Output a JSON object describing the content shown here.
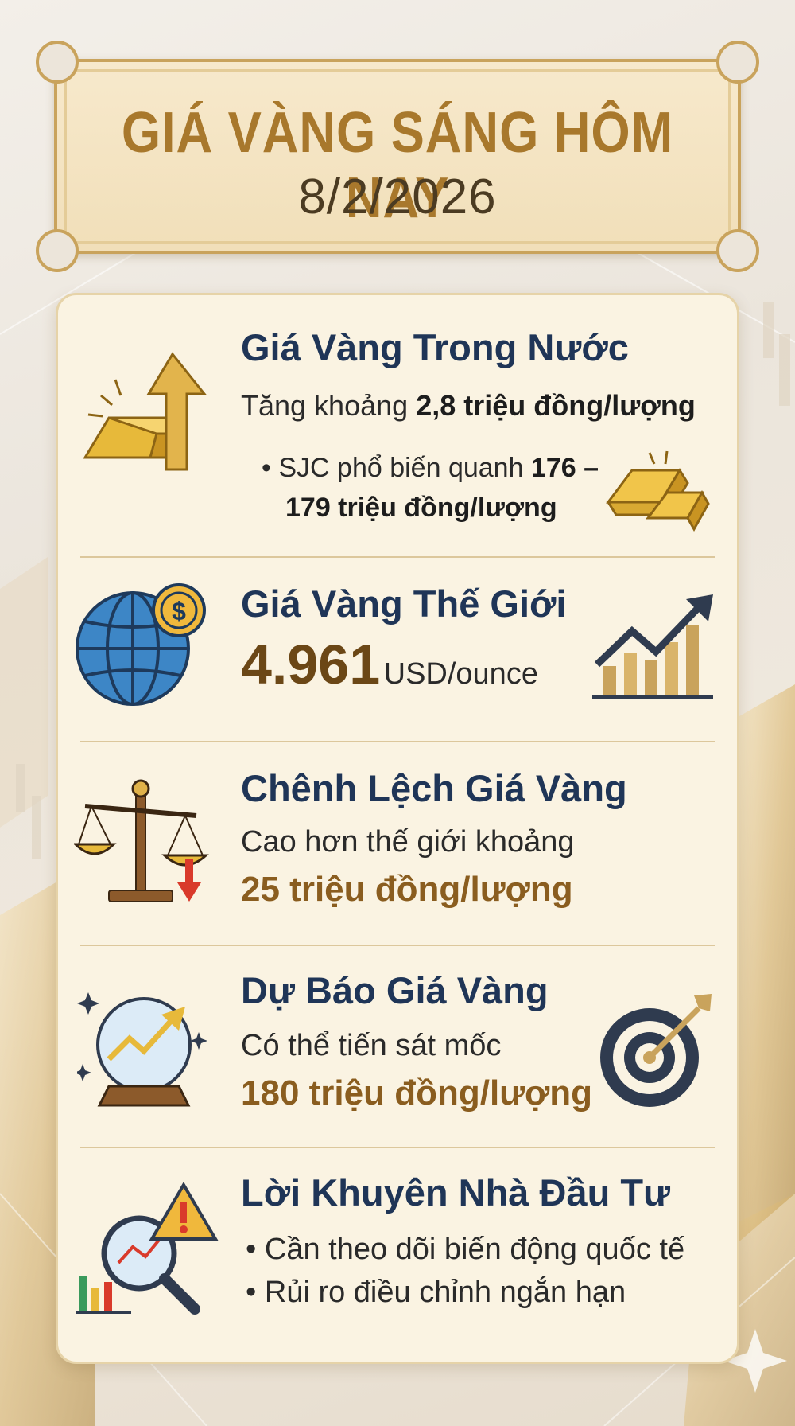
{
  "header": {
    "title": "GIÁ VÀNG SÁNG HÔM NAY",
    "date": "8/2/2026"
  },
  "sections": [
    {
      "heading": "Giá Vàng Trong Nước",
      "line_prefix": "Tăng khoảng",
      "line_value": "2,8 triệu đồng/lượng",
      "bullet_prefix": "SJC phổ biến quanh",
      "bullet_value_a": "176 –",
      "bullet_value_b": "179 triệu đồng/lượng",
      "icons": [
        "gold-bar-up-arrow-icon",
        "gold-bars-icon"
      ]
    },
    {
      "heading": "Giá Vàng Thế Giới",
      "value": "4.961",
      "unit": "USD/ounce",
      "icons": [
        "globe-dollar-icon",
        "rising-bar-chart-icon"
      ]
    },
    {
      "heading": "Chênh Lệch Giá Vàng",
      "line": "Cao hơn thế giới khoảng",
      "value": "25 triệu đồng/lượng",
      "icons": [
        "balance-scale-icon"
      ]
    },
    {
      "heading": "Dự Báo Giá Vàng",
      "line": "Có thể tiến sát mốc",
      "value": "180 triệu đồng/lượng",
      "icons": [
        "crystal-ball-icon",
        "target-icon"
      ]
    },
    {
      "heading": "Lời Khuyên Nhà Đầu Tư",
      "bullets": [
        "Cần theo dõi biến động quốc tế",
        "Rủi ro điều chỉnh ngắn hạn"
      ],
      "icons": [
        "magnifier-warning-icon"
      ]
    }
  ],
  "colors": {
    "heading": "#1f3557",
    "gold_accent": "#a8782c",
    "value_brown": "#8a5d1f",
    "card_bg": "#faf3e2"
  }
}
